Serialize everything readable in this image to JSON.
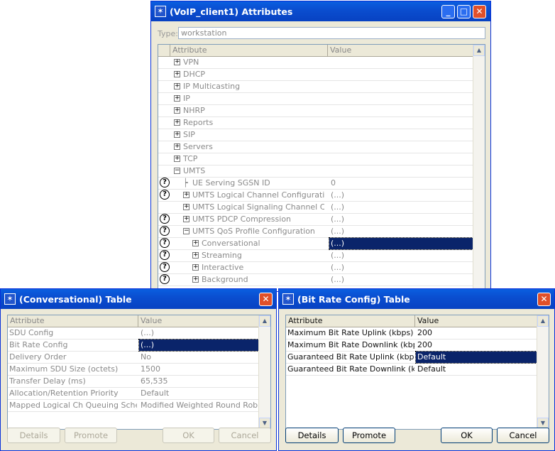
{
  "main_window": {
    "title": "(VoIP_client1) Attributes",
    "type_label": "Type:",
    "type_value": "workstation",
    "col_attribute": "Attribute",
    "col_value": "Value",
    "rows": [
      {
        "label": "VPN",
        "value": ""
      },
      {
        "label": "DHCP",
        "value": ""
      },
      {
        "label": "IP Multicasting",
        "value": ""
      },
      {
        "label": "IP",
        "value": ""
      },
      {
        "label": "NHRP",
        "value": ""
      },
      {
        "label": "Reports",
        "value": ""
      },
      {
        "label": "SIP",
        "value": ""
      },
      {
        "label": "Servers",
        "value": ""
      },
      {
        "label": "TCP",
        "value": ""
      },
      {
        "label": "UMTS",
        "value": ""
      },
      {
        "label": "UE Serving SGSN ID",
        "value": "0"
      },
      {
        "label": "UMTS Logical Channel Configuration",
        "value": "(...)"
      },
      {
        "label": "UMTS Logical Signaling Channel Conf...",
        "value": "(...)"
      },
      {
        "label": "UMTS PDCP Compression",
        "value": "(...)"
      },
      {
        "label": "UMTS QoS Profile Configuration",
        "value": "(...)"
      },
      {
        "label": "Conversational",
        "value": "(...)"
      },
      {
        "label": "Streaming",
        "value": "(...)"
      },
      {
        "label": "Interactive",
        "value": "(...)"
      },
      {
        "label": "Background",
        "value": "(...)"
      }
    ],
    "help_glyph": "?",
    "expand_glyph": "+",
    "collapse_glyph": "−"
  },
  "conv_table": {
    "title": "(Conversational) Table",
    "col_attribute": "Attribute",
    "col_value": "Value",
    "rows": [
      {
        "label": "SDU Config",
        "value": "(...)"
      },
      {
        "label": "Bit Rate Config",
        "value": "(...)"
      },
      {
        "label": "Delivery Order",
        "value": "No"
      },
      {
        "label": "Maximum SDU Size (octets)",
        "value": "1500"
      },
      {
        "label": "Transfer Delay (ms)",
        "value": "65,535"
      },
      {
        "label": "Allocation/Retention Priority",
        "value": "Default"
      },
      {
        "label": "Mapped Logical Ch Queuing Scheme",
        "value": "Modified Weighted Round Robin"
      }
    ],
    "buttons": {
      "details": "Details",
      "promote": "Promote",
      "ok": "OK",
      "cancel": "Cancel"
    }
  },
  "bitrate_table": {
    "title": "(Bit Rate Config) Table",
    "col_attribute": "Attribute",
    "col_value": "Value",
    "rows": [
      {
        "label": "Maximum Bit Rate Uplink (kbps)",
        "value": "200"
      },
      {
        "label": "Maximum Bit Rate Downlink (kbps)",
        "value": "200"
      },
      {
        "label": "Guaranteed Bit Rate Uplink (kbps)",
        "value": "Default"
      },
      {
        "label": "Guaranteed Bit Rate Downlink (kbps)",
        "value": "Default"
      }
    ],
    "buttons": {
      "details": "Details",
      "promote": "Promote",
      "ok": "OK",
      "cancel": "Cancel"
    }
  },
  "colors": {
    "titlebar": "#0a4ed0",
    "selection": "#0a246a",
    "window_bg": "#ece9d8",
    "close_button": "#e0502a"
  }
}
